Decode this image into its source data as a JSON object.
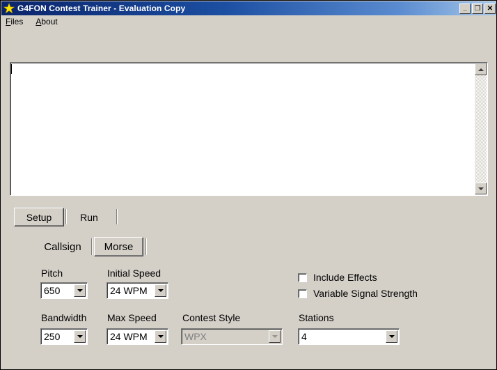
{
  "window": {
    "title": "G4FON Contest Trainer - Evaluation Copy",
    "icon": "star-icon",
    "controls": {
      "minimize": "_",
      "maximize": "❐",
      "close": "✕"
    }
  },
  "menu": {
    "items": [
      {
        "accel": "F",
        "rest": "iles"
      },
      {
        "accel": "A",
        "rest": "bout"
      }
    ]
  },
  "output_area": {
    "value": "",
    "scrollbar": {
      "up_arrow": "scroll-up-arrow",
      "down_arrow": "scroll-down-arrow"
    }
  },
  "tabs": {
    "items": [
      {
        "label": "Setup",
        "active": true
      },
      {
        "label": "Run",
        "active": false
      }
    ]
  },
  "subtabs": {
    "items": [
      {
        "label": "Callsign",
        "active": false
      },
      {
        "label": "Morse",
        "active": true
      }
    ]
  },
  "settings": {
    "pitch": {
      "label": "Pitch",
      "value": "650",
      "disabled": false
    },
    "initial_speed": {
      "label": "Initial Speed",
      "value": "24 WPM",
      "disabled": false
    },
    "bandwidth": {
      "label": "Bandwidth",
      "value": "250",
      "disabled": false
    },
    "max_speed": {
      "label": "Max Speed",
      "value": "24 WPM",
      "disabled": false
    },
    "contest_style": {
      "label": "Contest Style",
      "value": "WPX",
      "disabled": true
    },
    "stations": {
      "label": "Stations",
      "value": "4",
      "disabled": false
    }
  },
  "checkboxes": {
    "include_effects": {
      "label": "Include Effects",
      "checked": false
    },
    "variable_signal_strength": {
      "label": "Variable Signal Strength",
      "checked": false
    }
  },
  "colors": {
    "window_face": "#d4d0c8",
    "title_gradient_start": "#0a246a",
    "title_gradient_end": "#a6c8ea",
    "field_bg": "#ffffff",
    "disabled_text": "#808080",
    "star_icon": "#ffe400"
  }
}
